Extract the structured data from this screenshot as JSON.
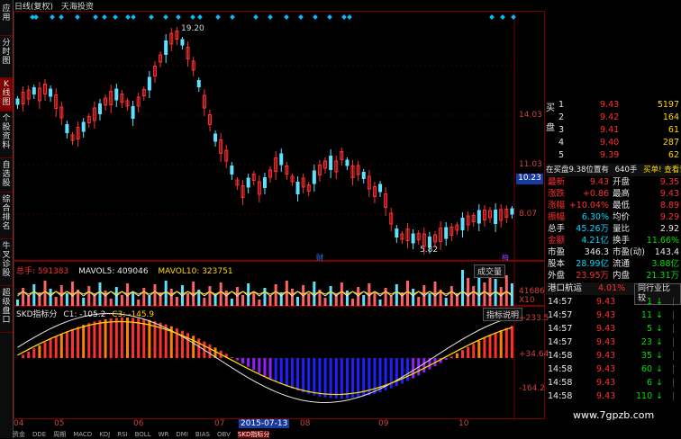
{
  "header": {
    "items": [
      "日线(复权)",
      "天海投资"
    ]
  },
  "leftbar": [
    {
      "label": "应用",
      "active": false
    },
    {
      "label": "分时图",
      "active": false
    },
    {
      "label": "K线图",
      "active": true
    },
    {
      "label": "个股资料",
      "active": false
    },
    {
      "label": "自选股",
      "active": false
    },
    {
      "label": "综合排名",
      "active": false
    },
    {
      "label": "牛叉诊股",
      "active": false
    },
    {
      "label": "超级盘口",
      "active": false
    }
  ],
  "price_chart": {
    "high_label": "19.20",
    "low_label": "5.82",
    "axis": [
      "14.03",
      "11.03",
      "8.07"
    ],
    "current_price": "10.23",
    "marker_cai": "财",
    "marker_mei": "梅"
  },
  "volume": {
    "total_label": "总手: 591383",
    "mavol5": "MAVOL5: 409046",
    "mavol10": "MAVOL10: 323751",
    "tab": "成交量",
    "axis_top": "41686",
    "axis_unit": "X10"
  },
  "indicator": {
    "name": "SKD指标分",
    "c1": "C1: -105.2",
    "c3": "C3: -145.9",
    "button": "指标说明",
    "axis": [
      "+233.5",
      "+34.64",
      "-164.2"
    ]
  },
  "timeline": {
    "months": [
      "04",
      "05",
      "06",
      "07",
      "08",
      "09",
      "10"
    ],
    "cursor_date": "2015-07-13"
  },
  "orderbook": {
    "side_label": "买盘",
    "rows": [
      {
        "level": "1",
        "price": "9.43",
        "vol": "5197"
      },
      {
        "level": "2",
        "price": "9.42",
        "vol": "164"
      },
      {
        "level": "3",
        "price": "9.41",
        "vol": "61"
      },
      {
        "level": "4",
        "price": "9.40",
        "vol": "287"
      },
      {
        "level": "5",
        "price": "9.39",
        "vol": "62"
      }
    ],
    "note_left": "在买盘9.38位置有",
    "note_mid": "640手",
    "note_right": "买单! 查看详细"
  },
  "quote": [
    {
      "k1": "最新",
      "v1": "9.43",
      "k2": "开盘",
      "v2": "9.35"
    },
    {
      "k1": "涨跌",
      "v1": "+0.86",
      "k2": "最高",
      "v2": "9.43"
    },
    {
      "k1": "涨幅",
      "v1": "+10.04%",
      "k2": "最低",
      "v2": "8.89"
    },
    {
      "k1": "振幅",
      "v1": "6.30%",
      "k2": "均价",
      "v2": "9.29"
    },
    {
      "k1": "总手",
      "v1": "45.26万",
      "k2": "量比",
      "v2": "2.92"
    },
    {
      "k1": "金额",
      "v1": "4.21亿",
      "k2": "换手",
      "v2": "11.66%"
    },
    {
      "k1": "市盈",
      "v1": "346.3",
      "k2": "市盈(动)",
      "v2": "143.4"
    },
    {
      "k1": "股本",
      "v1": "28.99亿",
      "k2": "流通",
      "v2": "3.88亿"
    },
    {
      "k1": "外盘",
      "v1": "23.95万",
      "k2": "内盘",
      "v2": "21.31万"
    }
  ],
  "sector": {
    "name": "港口航运",
    "pct": "4.01%",
    "compare": "同行业比较"
  },
  "ticks": [
    {
      "time": "14:57",
      "price": "9.43",
      "vol": "1"
    },
    {
      "time": "14:57",
      "price": "9.43",
      "vol": "11"
    },
    {
      "time": "14:57",
      "price": "9.43",
      "vol": "5"
    },
    {
      "time": "14:57",
      "price": "9.43",
      "vol": "23"
    },
    {
      "time": "14:58",
      "price": "9.43",
      "vol": "35"
    },
    {
      "time": "14:58",
      "price": "9.43",
      "vol": "60"
    },
    {
      "time": "14:58",
      "price": "9.43",
      "vol": "6"
    },
    {
      "time": "14:58",
      "price": "9.43",
      "vol": "110"
    }
  ],
  "watermark": "www.7gpzb.com",
  "bottom_tabs": [
    "资金",
    "DDE",
    "周期",
    "MACD",
    "KDJ",
    "RSI",
    "BOLL",
    "WR",
    "DMI",
    "BIAS",
    "OBV",
    "SKD指标分"
  ]
}
